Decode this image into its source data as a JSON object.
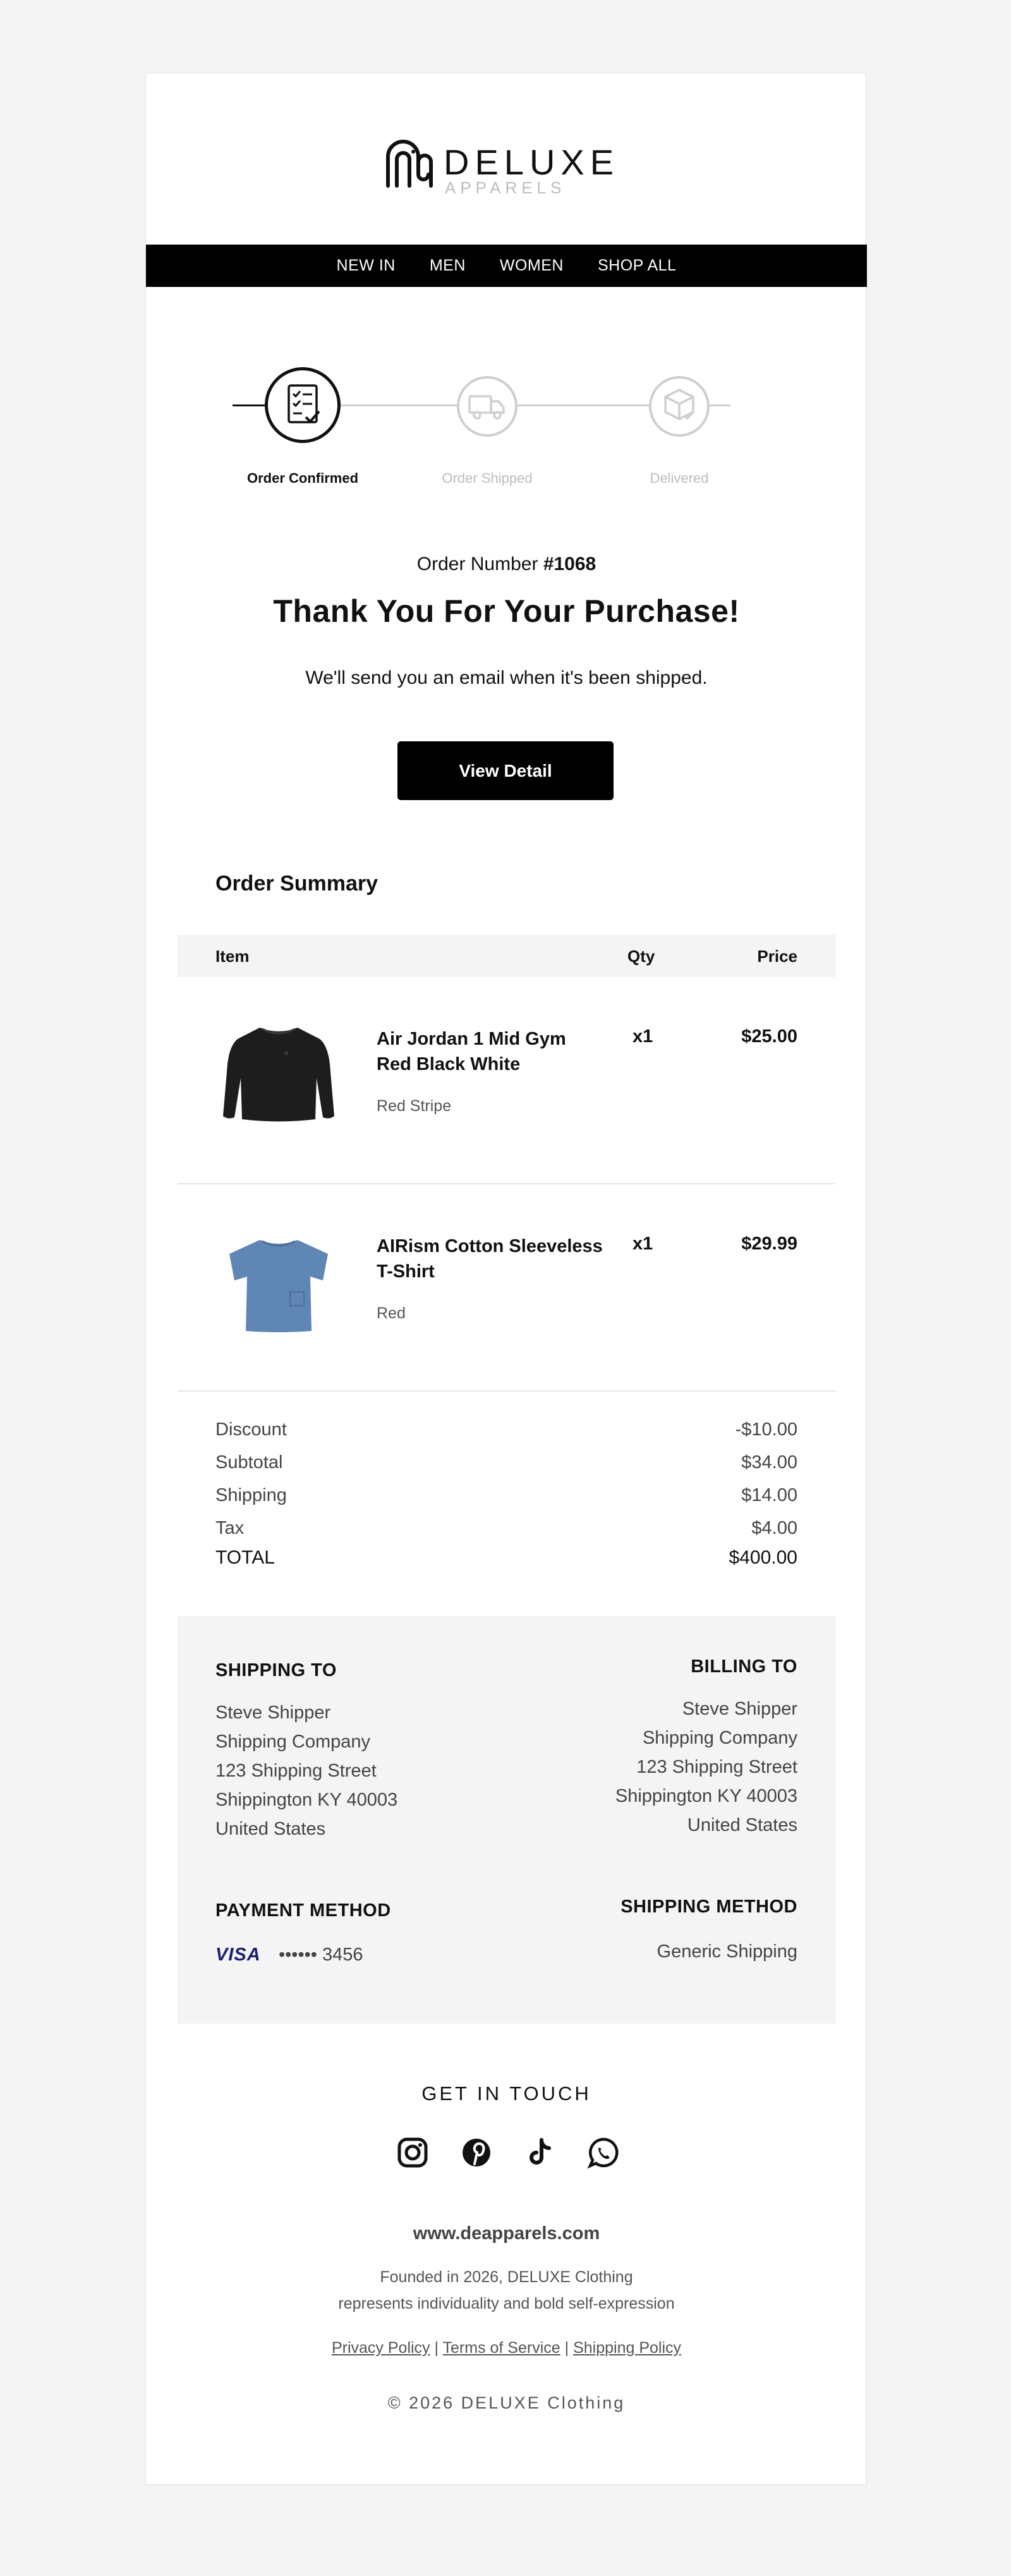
{
  "brand": {
    "name": "DELUXE",
    "sub": "APPARELS"
  },
  "nav": [
    "NEW IN",
    "MEN",
    "WOMEN",
    "SHOP ALL"
  ],
  "progress": {
    "steps": [
      {
        "label": "Order Confirmed",
        "state": "active"
      },
      {
        "label": "Order Shipped",
        "state": "pending"
      },
      {
        "label": "Delivered",
        "state": "pending"
      }
    ]
  },
  "order": {
    "number_label": "Order Number",
    "number": "#1068",
    "thanks": "Thank You For Your Purchase!",
    "message": "We'll send you an email when it's been shipped.",
    "view_detail": "View Detail"
  },
  "summary": {
    "title": "Order Summary",
    "columns": {
      "item": "Item",
      "qty": "Qty",
      "price": "Price"
    },
    "items": [
      {
        "name": "Air Jordan 1 Mid Gym Red Black White",
        "variant": "Red Stripe",
        "qty": "x1",
        "price": "$25.00",
        "image": "black-sweatshirt"
      },
      {
        "name": "AIRism Cotton Sleeveless T-Shirt",
        "variant": "Red",
        "qty": "x1",
        "price": "$29.99",
        "image": "blue-tshirt"
      }
    ],
    "totals": [
      {
        "label": "Discount",
        "value": "-$10.00"
      },
      {
        "label": "Subtotal",
        "value": "$34.00"
      },
      {
        "label": "Shipping",
        "value": "$14.00"
      },
      {
        "label": "Tax",
        "value": "$4.00"
      },
      {
        "label": "TOTAL",
        "value": "$400.00"
      }
    ]
  },
  "shipping_to": {
    "heading": "SHIPPING TO",
    "lines": [
      "Steve Shipper",
      "Shipping Company",
      "123 Shipping Street",
      "Shippington KY 40003",
      "United States"
    ]
  },
  "billing_to": {
    "heading": "BILLING TO",
    "lines": [
      "Steve Shipper",
      "Shipping Company",
      "123 Shipping Street",
      "Shippington KY 40003",
      "United States"
    ]
  },
  "payment": {
    "heading": "PAYMENT METHOD",
    "card_brand": "VISA",
    "card_masked": "•••••• 3456"
  },
  "shipping_method": {
    "heading": "SHIPPING METHOD",
    "value": "Generic Shipping"
  },
  "footer": {
    "get_in_touch": "GET IN TOUCH",
    "social": [
      "instagram-icon",
      "pinterest-icon",
      "tiktok-icon",
      "whatsapp-icon"
    ],
    "website": "www.deapparels.com",
    "founded_line1": "Founded in 2026, DELUXE Clothing",
    "founded_line2": "represents individuality and bold self-expression",
    "policies": [
      "Privacy Policy",
      "Terms of Service",
      "Shipping Policy"
    ],
    "copyright": "© 2026 DELUXE Clothing"
  },
  "colors": {
    "accent": "#000000",
    "muted": "#bdbdbd",
    "panel": "#f4f4f4",
    "visa": "#1a1f71"
  }
}
